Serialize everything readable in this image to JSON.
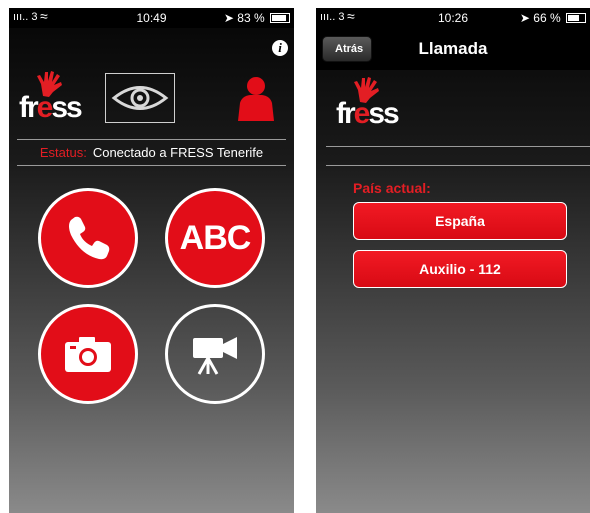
{
  "left": {
    "statusbar": {
      "signal": "ııı.. 3",
      "time": "10:49",
      "battery": "83 %"
    },
    "logo": {
      "text_pre": "fr",
      "text_e": "e",
      "text_post": "ss"
    },
    "status": {
      "label": "Estatus:",
      "value": "Conectado a FRESS Tenerife"
    },
    "buttons": {
      "abc": "ABC"
    }
  },
  "right": {
    "statusbar": {
      "signal": "ııı.. 3",
      "time": "10:26",
      "battery": "66 %"
    },
    "navbar": {
      "back": "Atrás",
      "title": "Llamada"
    },
    "logo": {
      "text_pre": "fr",
      "text_e": "e",
      "text_post": "ss"
    },
    "pais_label": "País actual:",
    "buttons": [
      "España",
      "Auxilio - 112"
    ]
  },
  "colors": {
    "accent": "#e20d18",
    "background_top": "#050505",
    "background_bottom": "#8a8a8a"
  },
  "levels": {
    "left_battery": 0.83,
    "right_battery": 0.66
  }
}
